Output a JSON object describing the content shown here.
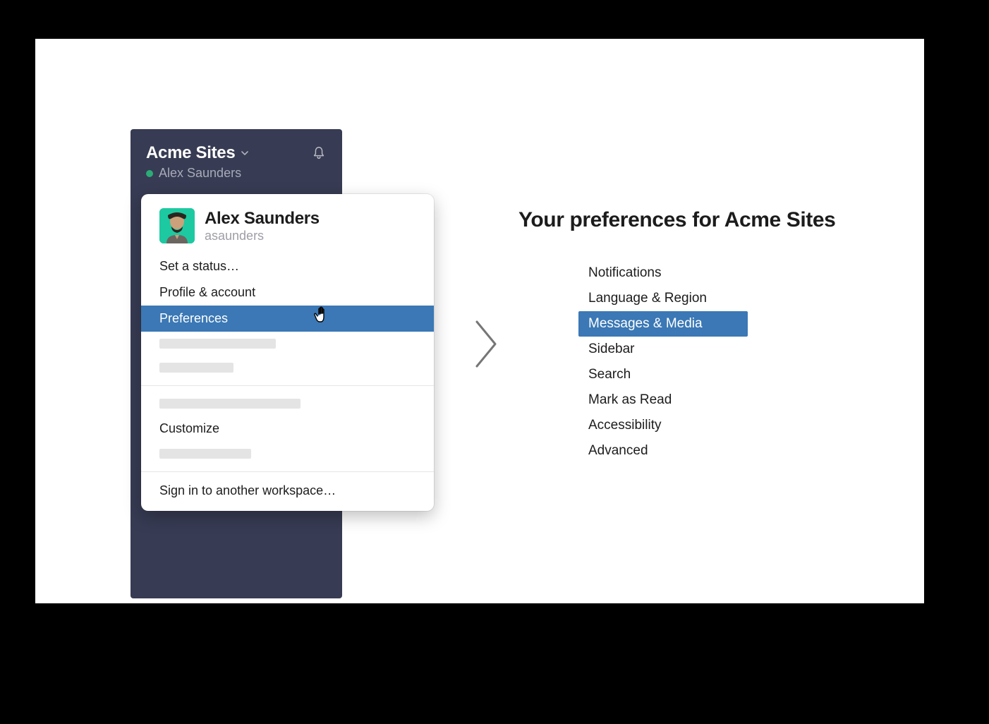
{
  "workspace": {
    "name": "Acme Sites",
    "user_display": "Alex Saunders"
  },
  "profile": {
    "full_name": "Alex Saunders",
    "handle": "asaunders"
  },
  "menu": {
    "set_status": "Set a status…",
    "profile_account": "Profile & account",
    "preferences": "Preferences",
    "customize": "Customize",
    "sign_in_another": "Sign in to another workspace…"
  },
  "preferences": {
    "title": "Your preferences for Acme Sites",
    "items": [
      "Notifications",
      "Language & Region",
      "Messages & Media",
      "Sidebar",
      "Search",
      "Mark as Read",
      "Accessibility",
      "Advanced"
    ],
    "selected_index": 2
  }
}
